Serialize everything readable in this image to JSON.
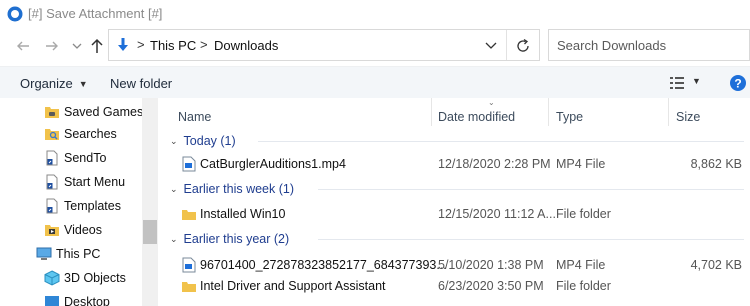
{
  "window": {
    "title": "[#] Save Attachment [#]"
  },
  "navigation": {
    "back_icon": "back-arrow-icon",
    "forward_icon": "forward-arrow-icon",
    "history_icon": "chevron-down-icon",
    "up_icon": "up-arrow-icon"
  },
  "address": {
    "segments": [
      "This PC",
      "Downloads"
    ],
    "separator": ">"
  },
  "search": {
    "placeholder": "Search Downloads"
  },
  "toolbar": {
    "organize_label": "Organize",
    "new_folder_label": "New folder"
  },
  "sidebar": {
    "items": [
      {
        "label": "Saved Games",
        "icon": "folder-saved-games-icon"
      },
      {
        "label": "Searches",
        "icon": "folder-search-icon"
      },
      {
        "label": "SendTo",
        "icon": "file-shortcut-icon"
      },
      {
        "label": "Start Menu",
        "icon": "file-shortcut-icon"
      },
      {
        "label": "Templates",
        "icon": "file-shortcut-icon"
      },
      {
        "label": "Videos",
        "icon": "folder-videos-icon"
      },
      {
        "label": "This PC",
        "icon": "computer-icon"
      },
      {
        "label": "3D Objects",
        "icon": "3d-objects-icon"
      },
      {
        "label": "Desktop",
        "icon": "desktop-icon"
      }
    ]
  },
  "columns": {
    "name": "Name",
    "date": "Date modified",
    "type": "Type",
    "size": "Size"
  },
  "groups": [
    {
      "label": "Today (1)",
      "files": [
        {
          "name": "CatBurglerAuditions1.mp4",
          "date": "12/18/2020 2:28 PM",
          "type": "MP4 File",
          "size": "8,862 KB",
          "icon": "video-file-icon"
        }
      ]
    },
    {
      "label": "Earlier this week (1)",
      "files": [
        {
          "name": "Installed Win10",
          "date": "12/15/2020 11:12 A...",
          "type": "File folder",
          "size": "",
          "icon": "folder-icon"
        }
      ]
    },
    {
      "label": "Earlier this year (2)",
      "files": [
        {
          "name": "96701400_272878323852177_684377393...",
          "date": "5/10/2020 1:38 PM",
          "type": "MP4 File",
          "size": "4,702 KB",
          "icon": "video-file-icon"
        },
        {
          "name": "Intel Driver and Support Assistant",
          "date": "6/23/2020 3:50 PM",
          "type": "File folder",
          "size": "",
          "icon": "folder-icon"
        }
      ]
    }
  ],
  "colors": {
    "accent": "#1f3d8f",
    "toolbar_bg": "#f3f6f9",
    "folder": "#f1c24b"
  }
}
